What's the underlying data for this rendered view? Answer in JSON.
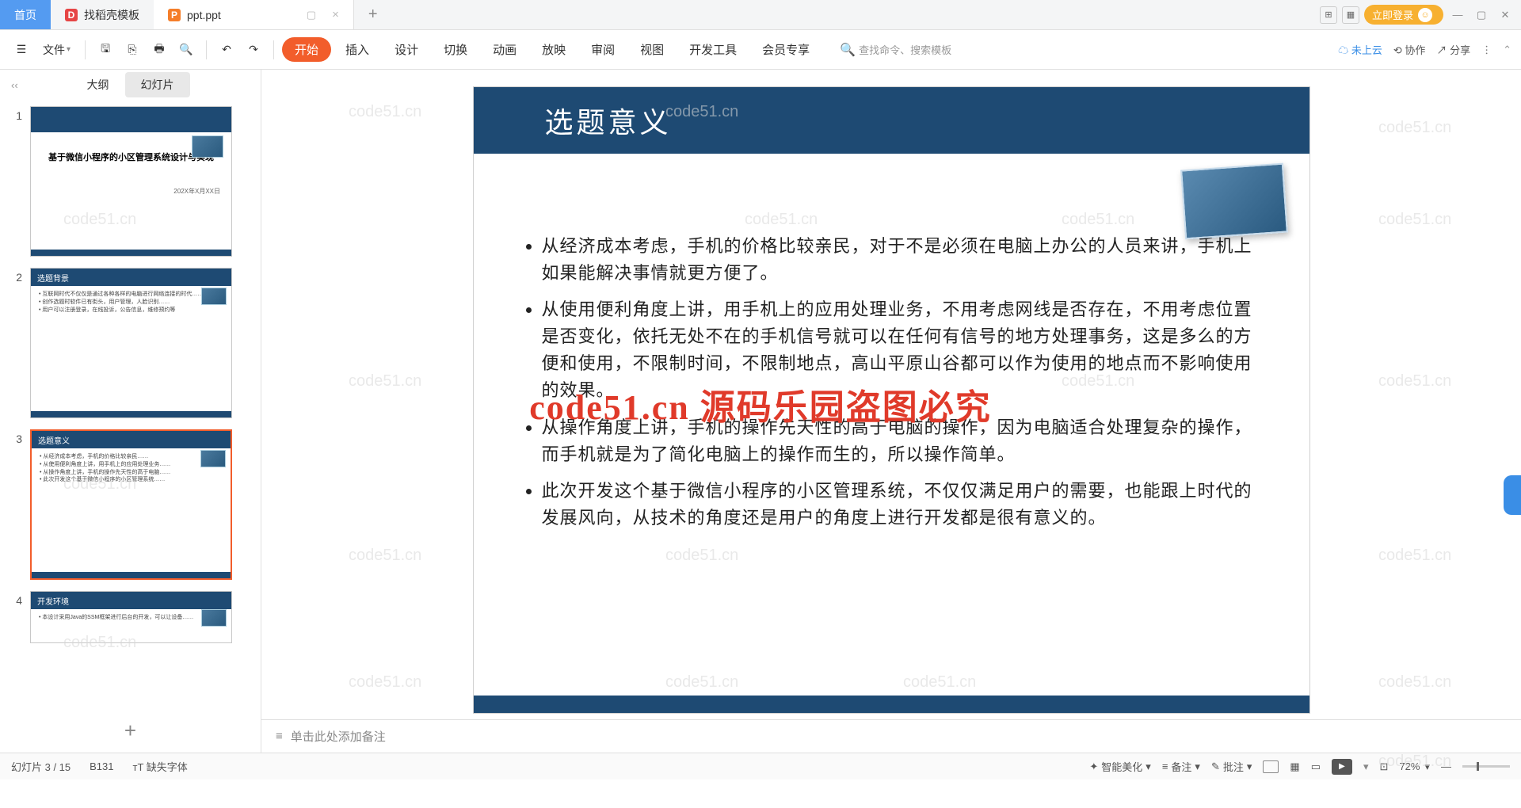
{
  "tabs": {
    "home": "首页",
    "t1": "找稻壳模板",
    "t2": "ppt.ppt"
  },
  "titleBtns": {
    "login": "立即登录"
  },
  "ribbon": {
    "file": "文件",
    "menus": [
      "开始",
      "插入",
      "设计",
      "切换",
      "动画",
      "放映",
      "审阅",
      "视图",
      "开发工具",
      "会员专享"
    ],
    "search": "查找命令、搜索模板",
    "cloud": "未上云",
    "collab": "协作",
    "share": "分享"
  },
  "side": {
    "outline": "大纲",
    "slides": "幻灯片"
  },
  "thumbs": {
    "t1_title": "基于微信小程序的小区管理系统设计与实现",
    "t1_date": "202X年X月XX日",
    "t2_hdr": "选题背景",
    "t3_hdr": "选题意义",
    "t4_hdr": "开发环境"
  },
  "slide": {
    "title": "选题意义",
    "b1": "从经济成本考虑，手机的价格比较亲民，对于不是必须在电脑上办公的人员来讲，手机上如果能解决事情就更方便了。",
    "b2": "从使用便利角度上讲，用手机上的应用处理业务，不用考虑网线是否存在，不用考虑位置是否变化，依托无处不在的手机信号就可以在任何有信号的地方处理事务，这是多么的方便和使用，不限制时间，不限制地点，高山平原山谷都可以作为使用的地点而不影响使用的效果。",
    "b3": "从操作角度上讲，手机的操作先天性的高于电脑的操作，因为电脑适合处理复杂的操作，而手机就是为了简化电脑上的操作而生的，所以操作简单。",
    "b4": "此次开发这个基于微信小程序的小区管理系统，不仅仅满足用户的需要，也能跟上时代的发展风向，从技术的角度还是用户的角度上进行开发都是很有意义的。"
  },
  "wm": "code51.cn",
  "wm_red": "code51.cn 源码乐园盗图必究",
  "notes": "单击此处添加备注",
  "status": {
    "pos": "幻灯片 3 / 15",
    "b": "B131",
    "font": "缺失字体",
    "beauty": "智能美化",
    "note": "备注",
    "comment": "批注",
    "zoom": "72%"
  }
}
